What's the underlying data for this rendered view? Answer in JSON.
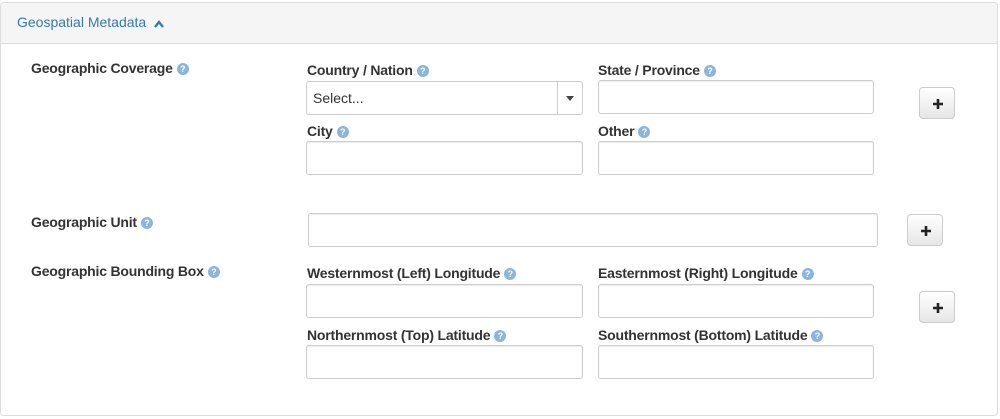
{
  "section": {
    "title": "Geospatial Metadata"
  },
  "coverage": {
    "label": "Geographic Coverage",
    "country_label": "Country / Nation",
    "country_value": "Select...",
    "state_label": "State / Province",
    "city_label": "City",
    "other_label": "Other"
  },
  "unit": {
    "label": "Geographic Unit"
  },
  "bbox": {
    "label": "Geographic Bounding Box",
    "west_label": "Westernmost (Left) Longitude",
    "east_label": "Easternmost (Right) Longitude",
    "north_label": "Northernmost (Top) Latitude",
    "south_label": "Southernmost (Bottom) Latitude"
  },
  "icons": {
    "help": "?",
    "add": "plus-icon",
    "collapse": "chevron-up-icon"
  },
  "colors": {
    "link": "#337ab7",
    "help_icon": "#8cb5dd",
    "header_bg": "#f5f5f5"
  }
}
